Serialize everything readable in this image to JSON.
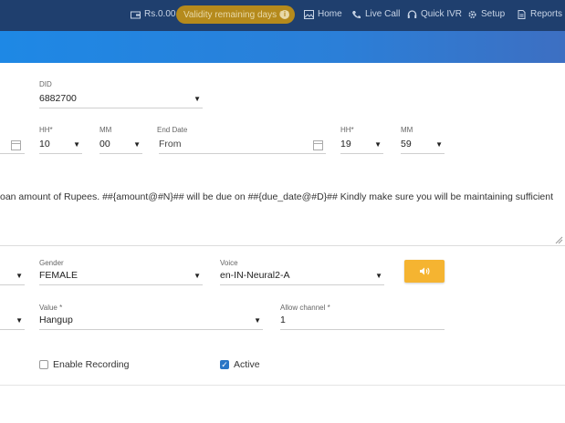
{
  "topbar": {
    "balance": "Rs.0.00",
    "validity": "Validity remaining days 68",
    "nav": [
      {
        "label": "Home",
        "icon": "image-icon"
      },
      {
        "label": "Live Call",
        "icon": "phone-icon"
      },
      {
        "label": "Quick IVR",
        "icon": "headset-icon"
      },
      {
        "label": "Setup",
        "icon": "gear-icon"
      },
      {
        "label": "Reports",
        "icon": "document-icon"
      }
    ]
  },
  "did": {
    "label": "DID",
    "value": "6882700"
  },
  "schedule": {
    "start_hh_label": "HH*",
    "start_hh": "10",
    "start_mm_label": "MM",
    "start_mm": "00",
    "end_date_label": "End Date",
    "end_date": "From",
    "end_hh_label": "HH*",
    "end_hh": "19",
    "end_mm_label": "MM",
    "end_mm": "59"
  },
  "message": "oan amount of Rupees. ##{amount@#N}## will be due on ##{due_date@#D}## Kindly make sure you will be maintaining sufficient",
  "voice_settings": {
    "gender_label": "Gender",
    "gender": "FEMALE",
    "voice_label": "Voice",
    "voice": "en-IN-Neural2-A"
  },
  "action": {
    "value_label": "Value *",
    "value": "Hangup",
    "channel_label": "Allow channel *",
    "channel": "1"
  },
  "options": {
    "recording_label": "Enable Recording",
    "recording": false,
    "active_label": "Active",
    "active": true
  },
  "colors": {
    "topbar": "#1f3f6e",
    "accent": "#f5b431",
    "check": "#2a76c6"
  }
}
